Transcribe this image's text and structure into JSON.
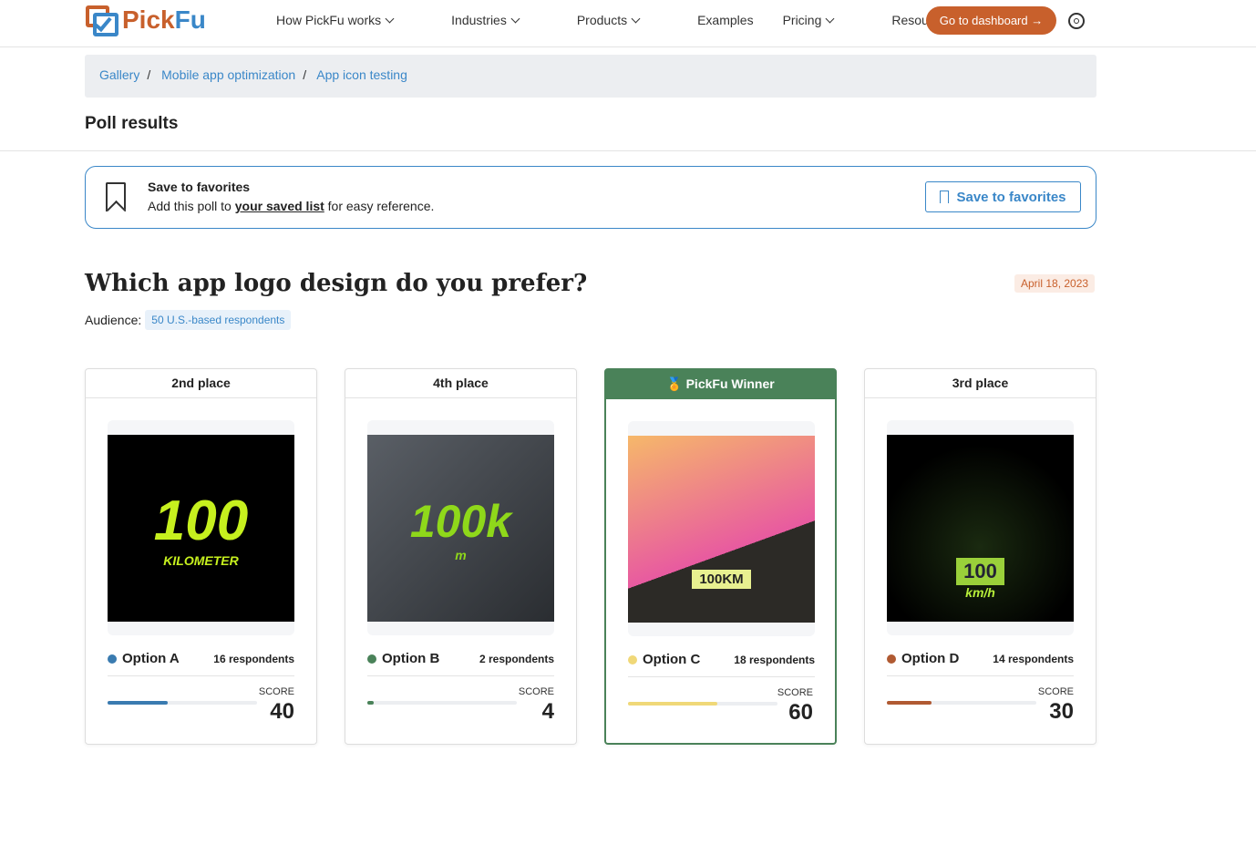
{
  "nav": {
    "logo_pick": "Pick",
    "logo_fu": "Fu",
    "items": [
      "How PickFu works",
      "Industries",
      "Products",
      "Examples",
      "Pricing",
      "Resources"
    ],
    "dropdown": [
      true,
      true,
      true,
      false,
      true,
      true
    ],
    "dashboard": "Go to dashboard →"
  },
  "breadcrumb": [
    "Gallery",
    "Mobile app optimization",
    "App icon testing"
  ],
  "page_title": "Poll results",
  "favorites": {
    "title": "Save to favorites",
    "desc_pre": "Add this poll to ",
    "link": "your saved list",
    "desc_post": " for easy reference.",
    "button": "Save to favorites"
  },
  "poll": {
    "question": "Which app logo design do you prefer?",
    "date": "April 18, 2023",
    "audience_label": "Audience:",
    "audience": "50 U.S.-based respondents"
  },
  "score_label": "SCORE",
  "options": [
    {
      "place": "2nd place",
      "name": "Option A",
      "respondents": "16 respondents",
      "score": "40",
      "score_pct": 40,
      "color": "#3a7bb0",
      "image_text": "100",
      "image_sub": "KILOMETER"
    },
    {
      "place": "4th place",
      "name": "Option B",
      "respondents": "2 respondents",
      "score": "4",
      "score_pct": 4,
      "color": "#4a8259",
      "image_text": "100k",
      "image_sub": "m"
    },
    {
      "place": "PickFu Winner",
      "name": "Option C",
      "respondents": "18 respondents",
      "score": "60",
      "score_pct": 60,
      "color": "#f0d878",
      "image_text": "100KM",
      "image_sub": ""
    },
    {
      "place": "3rd place",
      "name": "Option D",
      "respondents": "14 respondents",
      "score": "30",
      "score_pct": 30,
      "color": "#b05a32",
      "image_text": "100",
      "image_sub": "km/h"
    }
  ]
}
